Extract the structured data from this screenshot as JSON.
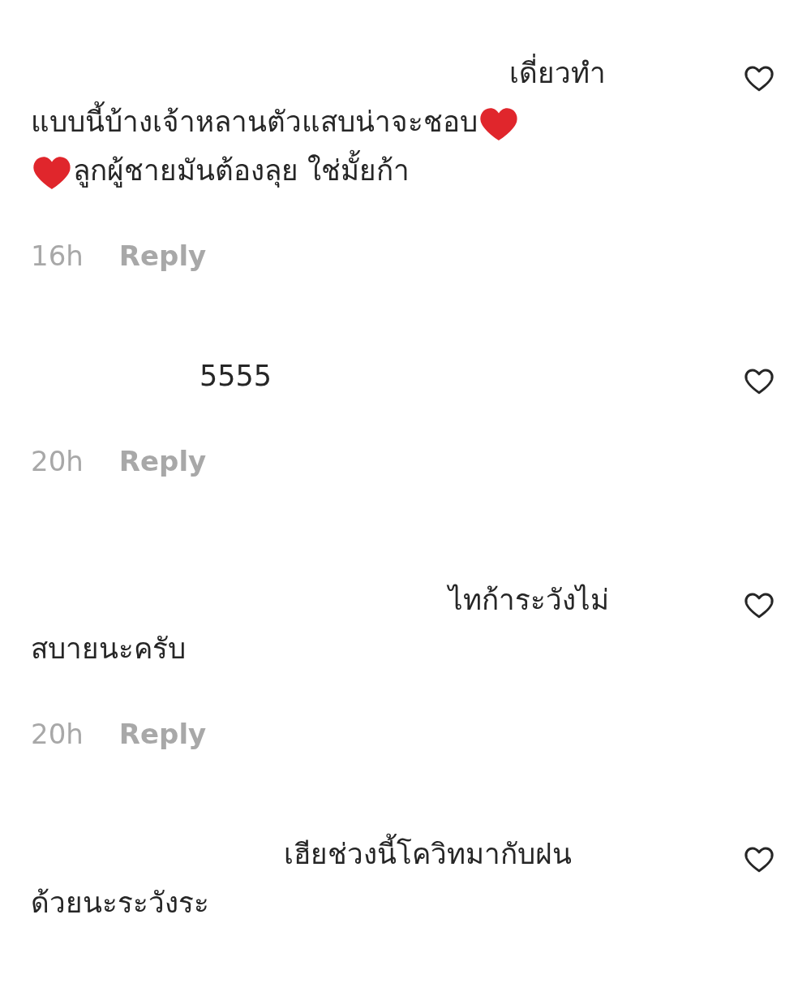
{
  "comments": [
    {
      "lines": [
        [
          {
            "kind": "text",
            "text": "เดี่ยวทำ"
          }
        ],
        [
          {
            "kind": "text",
            "text": "แบบนี้บ้างเจ้าหลานตัวแสบน่าจะชอบ"
          },
          {
            "kind": "heart"
          }
        ],
        [
          {
            "kind": "heart"
          },
          {
            "kind": "text",
            "text": "ลูกผู้ชายมันต้องลุย ใช่มั้ยก้า"
          }
        ]
      ],
      "time": "16h",
      "reply": "Reply",
      "liked": false
    },
    {
      "lines": [
        [
          {
            "kind": "text",
            "text": "5555"
          }
        ]
      ],
      "time": "20h",
      "reply": "Reply",
      "liked": false
    },
    {
      "lines": [
        [
          {
            "kind": "text",
            "text": "ไทก้าระวังไม่"
          }
        ],
        [
          {
            "kind": "text",
            "text": "สบายนะครับ"
          }
        ]
      ],
      "time": "20h",
      "reply": "Reply",
      "liked": false
    },
    {
      "lines": [
        [
          {
            "kind": "text",
            "text": "เฮียช่วงนี้โควิทมากับฝน"
          }
        ],
        [
          {
            "kind": "text",
            "text": "ด้วยนะระวังระ"
          }
        ]
      ],
      "liked": false
    }
  ]
}
